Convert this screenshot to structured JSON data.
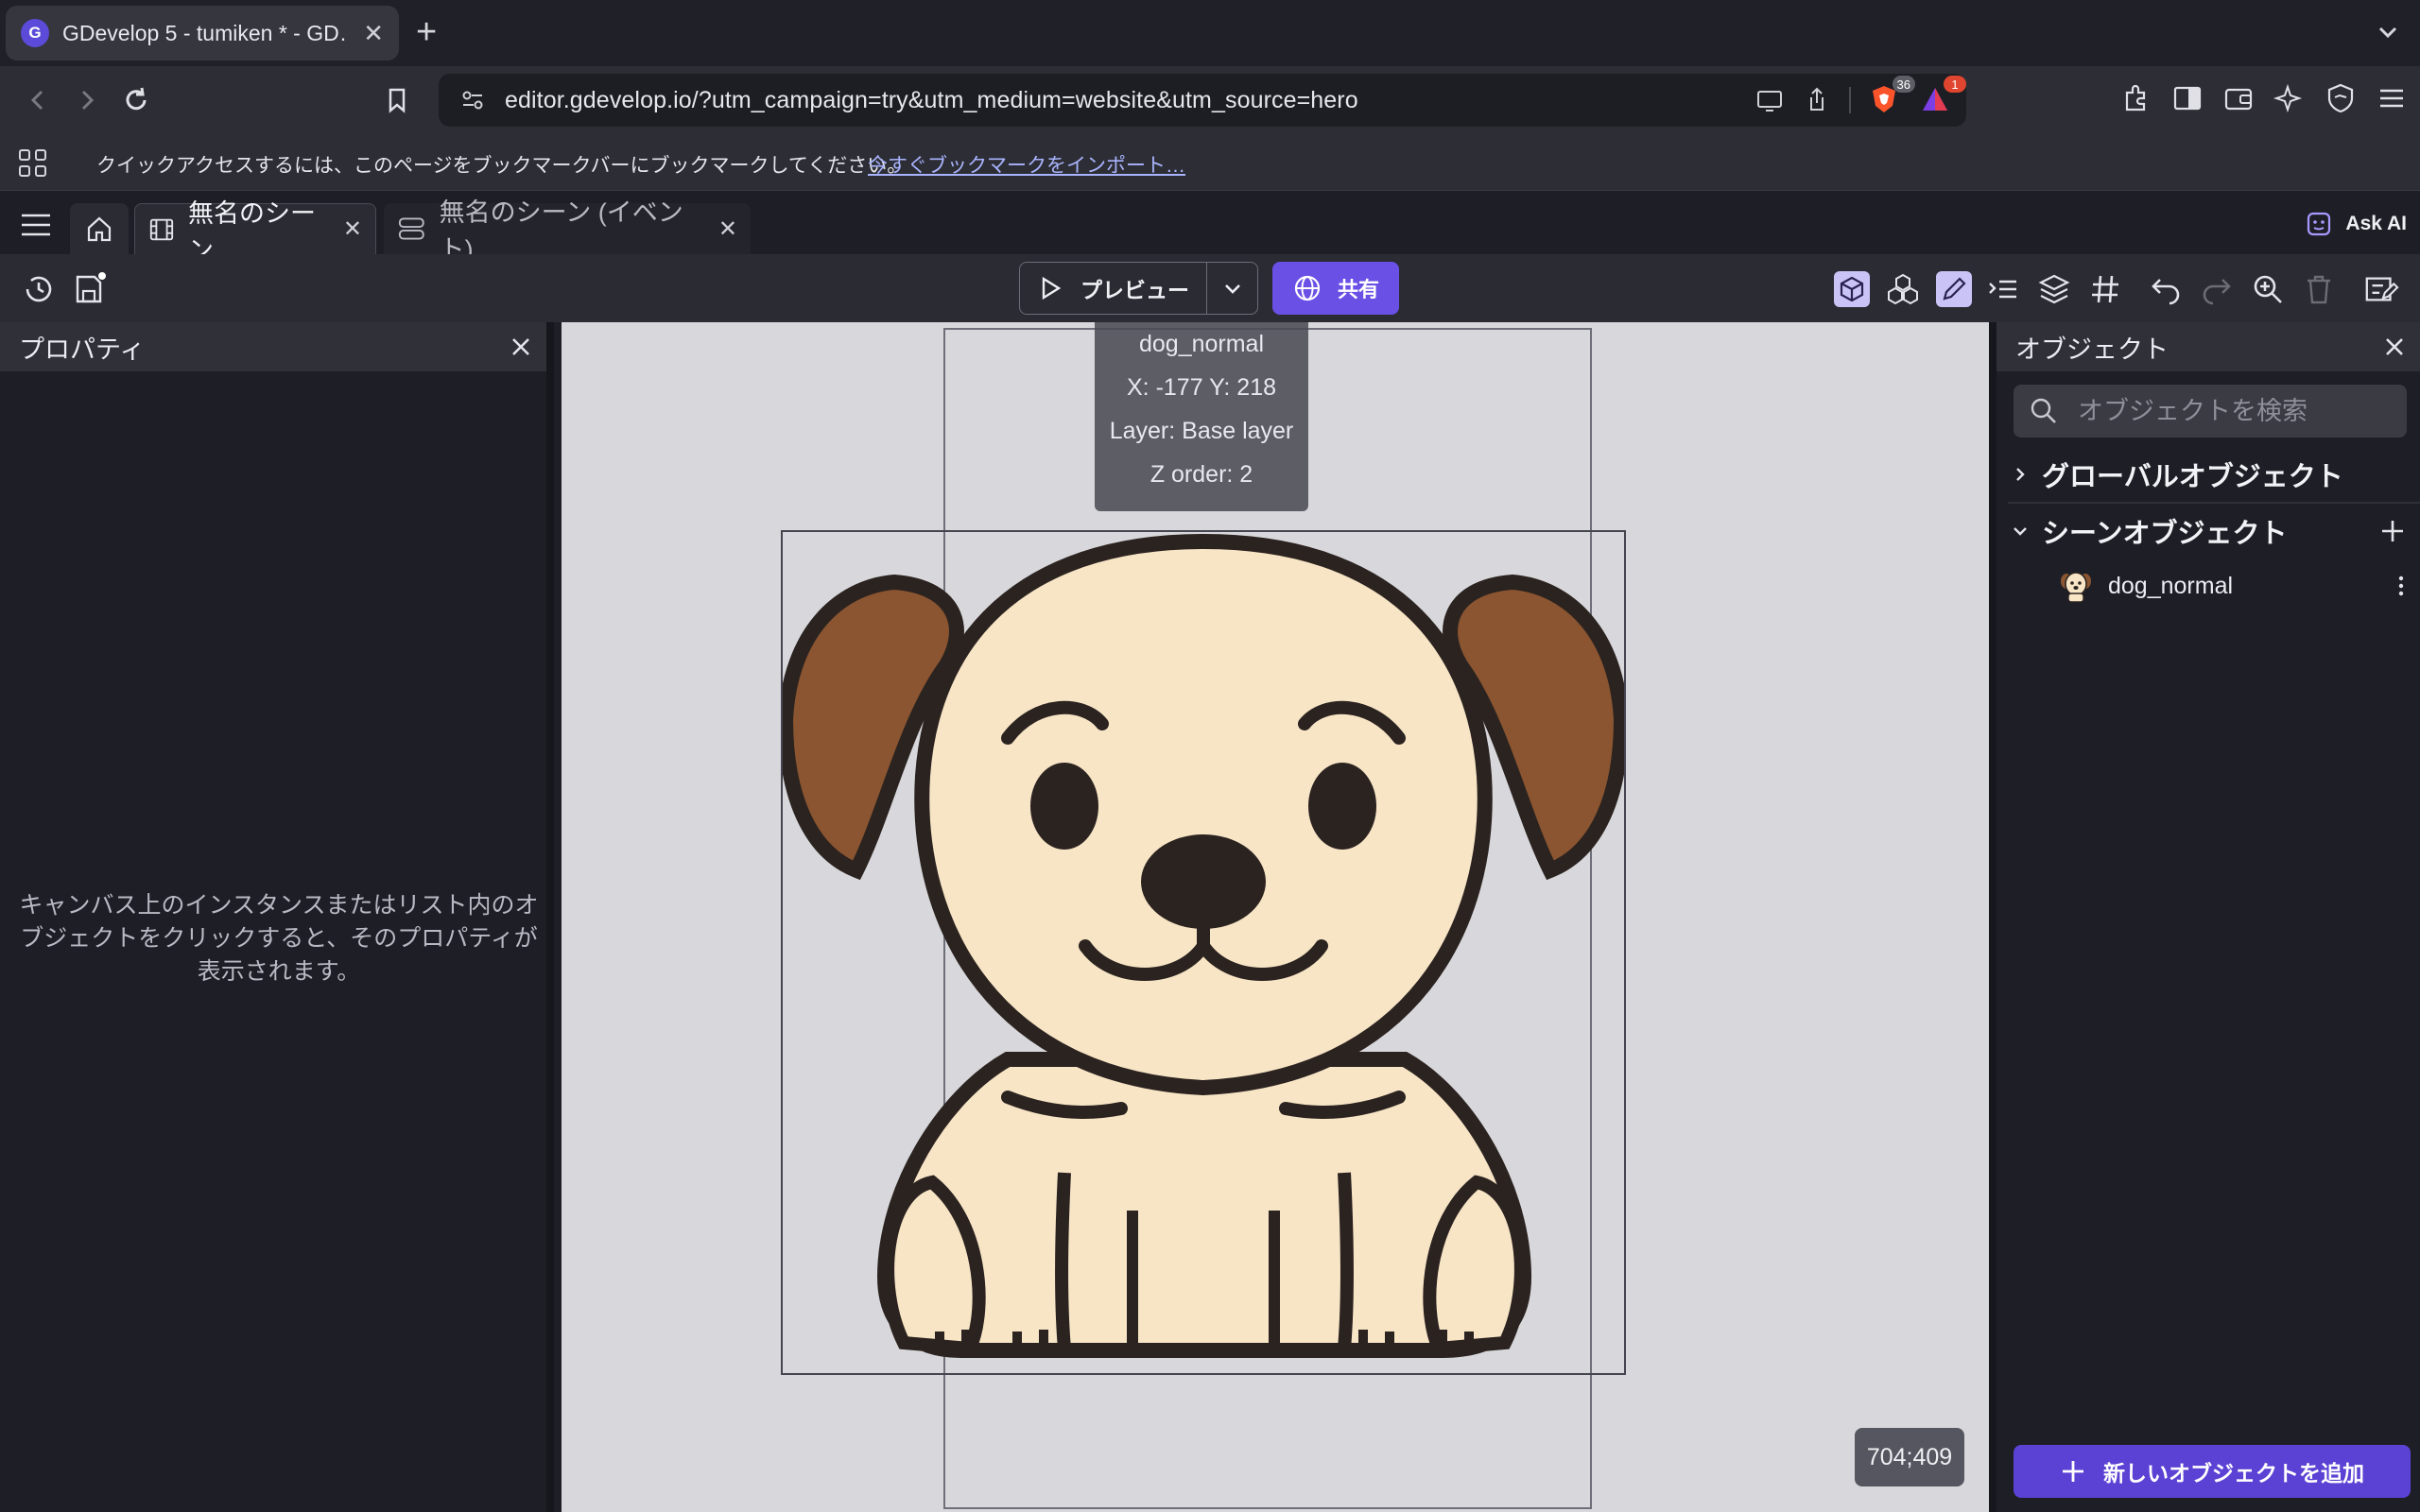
{
  "browser": {
    "tab_title": "GDevelop 5 - tumiken * - GD…",
    "url": "editor.gdevelop.io/?utm_campaign=try&utm_medium=website&utm_source=hero",
    "brave_badge": "36",
    "alert_badge": "1",
    "bookmark_message": "クイックアクセスするには、このページをブックマークバーにブックマークしてください。",
    "bookmark_link": "今すぐブックマークをインポート…"
  },
  "app": {
    "tabs": [
      {
        "label": "無名のシーン"
      },
      {
        "label": "無名のシーン (イベント)"
      }
    ],
    "ask_ai": "Ask AI",
    "toolbar": {
      "preview_label": "プレビュー",
      "share_label": "共有"
    },
    "left_panel": {
      "title": "プロパティ",
      "hint": "キャンバス上のインスタンスまたはリスト内のオブジェクトをクリックすると、そのプロパティが表示されます。"
    },
    "canvas": {
      "tooltip": {
        "name": "dog_normal",
        "position": "X: -177  Y: 218",
        "layer": "Layer: Base layer",
        "z_order": "Z order: 2"
      },
      "coords": "704;409"
    },
    "right_panel": {
      "title": "オブジェクト",
      "search_placeholder": "オブジェクトを検索",
      "global_objects": "グローバルオブジェクト",
      "scene_objects": "シーンオブジェクト",
      "objects": [
        {
          "name": "dog_normal"
        }
      ],
      "add_button": "新しいオブジェクトを追加"
    }
  },
  "colors": {
    "accent": "#6b50e6",
    "dog_body": "#f8e5c6",
    "dog_ears": "#8a5530",
    "dog_outline": "#2b2320"
  }
}
